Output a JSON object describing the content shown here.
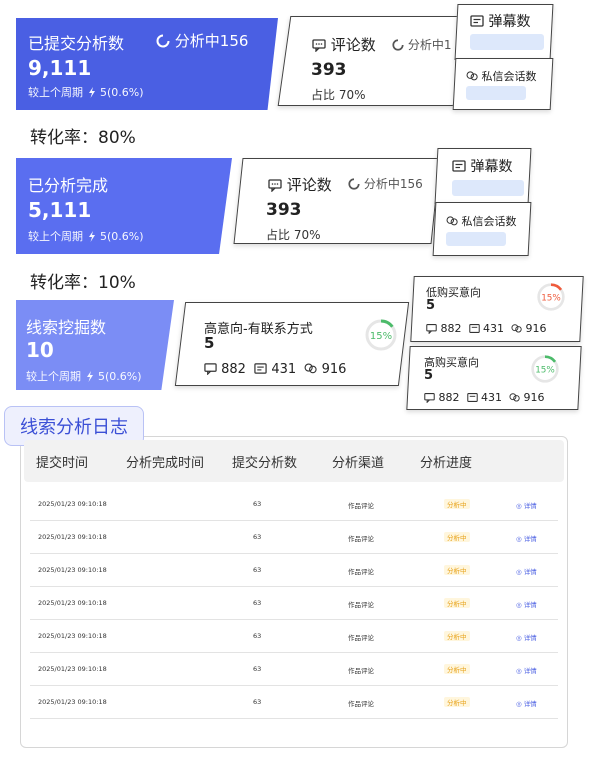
{
  "funnel": [
    {
      "title": "已提交分析数",
      "value": "9,111",
      "compare": "较上个周期",
      "change": "5(0.6%)",
      "status": "分析中156"
    },
    {
      "title": "已分析完成",
      "value": "5,111",
      "compare": "较上个周期",
      "change": "5(0.6%)"
    },
    {
      "title": "线索挖掘数",
      "value": "10",
      "compare": "较上个周期",
      "change": "5(0.6%)"
    }
  ],
  "conversion": [
    "转化率：80%",
    "转化率：10%"
  ],
  "card1": {
    "title": "评论数",
    "status": "分析中1",
    "value": "393",
    "ratio": "占比 70%",
    "side_top": "弹幕数",
    "side_bottom": "私信会话数"
  },
  "card2": {
    "title": "评论数",
    "status": "分析中156",
    "value": "393",
    "ratio": "占比 70%",
    "side_top": "弹幕数",
    "side_bottom": "私信会话数"
  },
  "card3": {
    "title": "高意向-有联系方式",
    "value": "5",
    "ring": "15%",
    "ring_pct": 15,
    "ring_color": "#4cbb6a",
    "stats": [
      "882",
      "431",
      "916"
    ]
  },
  "card4": {
    "title": "低购买意向",
    "value": "5",
    "ring": "15%",
    "ring_pct": 15,
    "ring_color": "#ef5b3c",
    "stats": [
      "882",
      "431",
      "916"
    ]
  },
  "card5": {
    "title": "高购买意向",
    "value": "5",
    "ring": "15%",
    "ring_pct": 15,
    "ring_color": "#4cbb6a",
    "stats": [
      "882",
      "431",
      "916"
    ]
  },
  "log": {
    "title": "线索分析日志",
    "headers": [
      "提交时间",
      "分析完成时间",
      "提交分析数",
      "分析渠道",
      "分析进度"
    ],
    "rows": [
      {
        "time": "2025/01/23 09:10:18",
        "count": "63",
        "channel": "作品评论",
        "status": "分析中",
        "action": "详情"
      },
      {
        "time": "2025/01/23 09:10:18",
        "count": "63",
        "channel": "作品评论",
        "status": "分析中",
        "action": "详情"
      },
      {
        "time": "2025/01/23 09:10:18",
        "count": "63",
        "channel": "作品评论",
        "status": "分析中",
        "action": "详情"
      },
      {
        "time": "2025/01/23 09:10:18",
        "count": "63",
        "channel": "作品评论",
        "status": "分析中",
        "action": "详情"
      },
      {
        "time": "2025/01/23 09:10:18",
        "count": "63",
        "channel": "作品评论",
        "status": "分析中",
        "action": "详情"
      },
      {
        "time": "2025/01/23 09:10:18",
        "count": "63",
        "channel": "作品评论",
        "status": "分析中",
        "action": "详情"
      },
      {
        "time": "2025/01/23 09:10:18",
        "count": "63",
        "channel": "作品评论",
        "status": "分析中",
        "action": "详情"
      }
    ]
  },
  "colors": {
    "primary": "#4a5fe3",
    "warning": "#e7a21a",
    "success": "#4cbb6a",
    "danger": "#ef5b3c"
  }
}
